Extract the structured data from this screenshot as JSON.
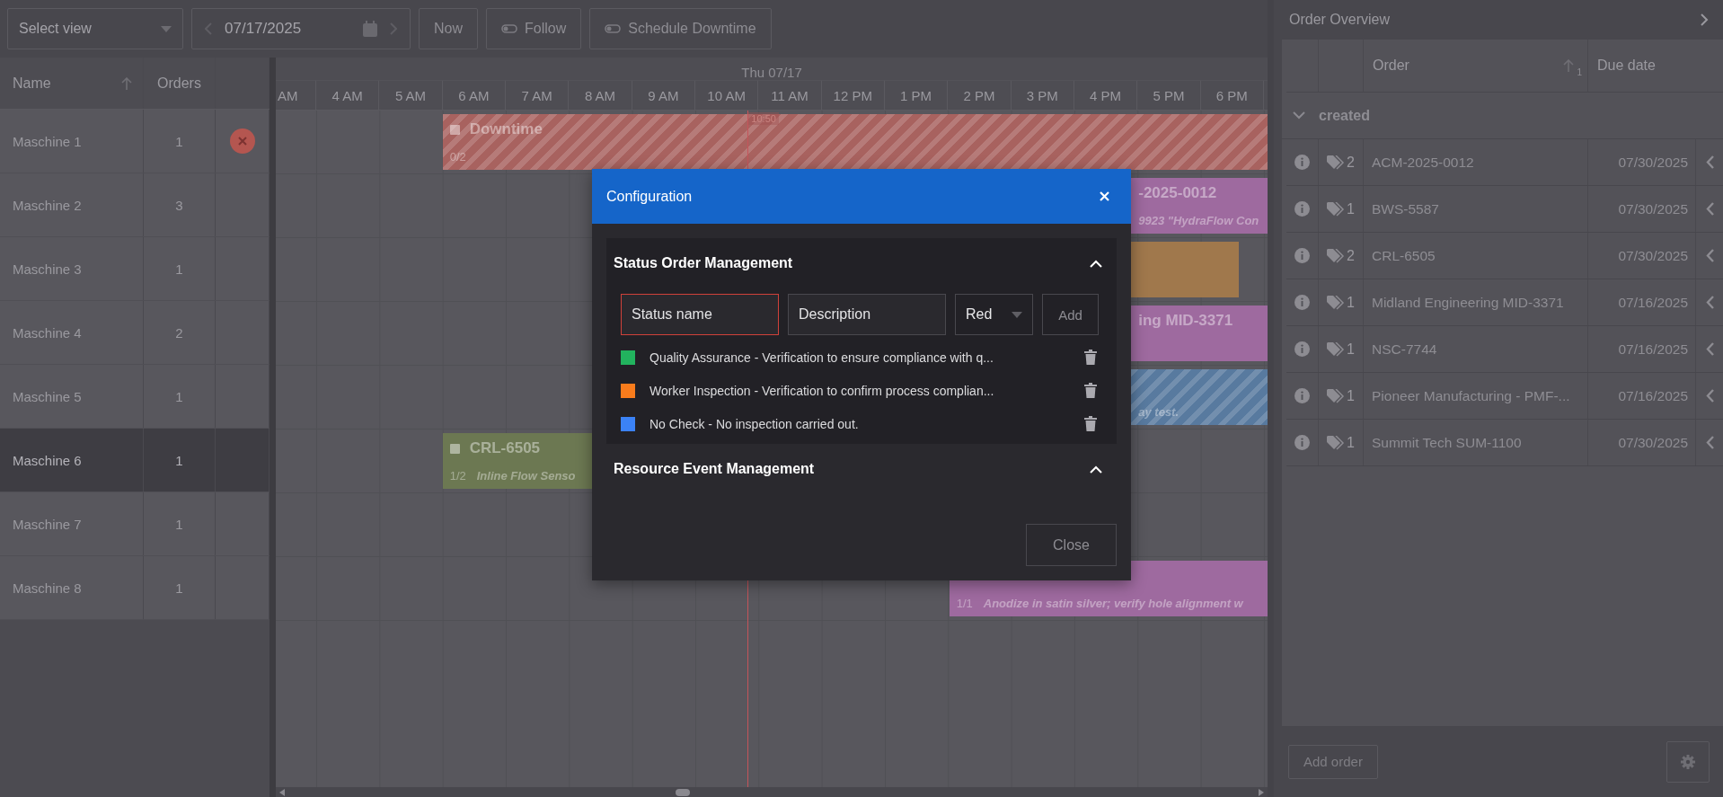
{
  "toolbar": {
    "view_select": {
      "value": "Select view"
    },
    "date": "07/17/2025",
    "buttons": [
      {
        "label": "Now",
        "kind": "plain",
        "on": false
      },
      {
        "label": "Follow",
        "kind": "toggle",
        "on": false
      },
      {
        "label": "Schedule Downtime",
        "kind": "toggle",
        "on": false
      }
    ]
  },
  "resources": {
    "columns": [
      "Name",
      "Orders"
    ],
    "rows": [
      {
        "name": "Maschine 1",
        "orders": "1",
        "cancel": true,
        "selected": false
      },
      {
        "name": "Maschine 2",
        "orders": "3",
        "cancel": false,
        "selected": false
      },
      {
        "name": "Maschine 3",
        "orders": "1",
        "cancel": false,
        "selected": false
      },
      {
        "name": "Maschine 4",
        "orders": "2",
        "cancel": false,
        "selected": false
      },
      {
        "name": "Maschine 5",
        "orders": "1",
        "cancel": false,
        "selected": false
      },
      {
        "name": "Maschine 6",
        "orders": "1",
        "cancel": false,
        "selected": true
      },
      {
        "name": "Maschine 7",
        "orders": "1",
        "cancel": false,
        "selected": false
      },
      {
        "name": "Maschine 8",
        "orders": "1",
        "cancel": false,
        "selected": false
      }
    ]
  },
  "timeline": {
    "day": "Thu 07/17",
    "hours": [
      "AM",
      "4 AM",
      "5 AM",
      "6 AM",
      "7 AM",
      "8 AM",
      "9 AM",
      "10 AM",
      "11 AM",
      "12 PM",
      "1 PM",
      "2 PM",
      "3 PM",
      "4 PM",
      "5 PM",
      "6 PM"
    ],
    "now": {
      "label": "10:50"
    },
    "rows": [
      {
        "bars": [
          {
            "title": "Downtime",
            "count": "0/2",
            "color": "#a8625f",
            "striped": true
          }
        ]
      },
      {
        "bars": [
          {
            "title": "-2025-0012",
            "subtitle": "9923 \"HydraFlow Con",
            "color": "#9e6a9f",
            "striped": false
          }
        ]
      },
      {
        "bars": [
          {
            "color": "#a0784c",
            "striped": false
          }
        ]
      },
      {
        "bars": [
          {
            "title": "ing MID-3371",
            "color": "#9e6a9f",
            "striped": false
          }
        ]
      },
      {
        "bars": [
          {
            "subtitle": "ay test.",
            "color": "#587a9f",
            "striped": true
          }
        ]
      },
      {
        "bars": [
          {
            "title": "CRL-6505",
            "count": "1/2",
            "subtitle": "Inline Flow Senso",
            "color": "#6c7852",
            "striped": false
          }
        ]
      },
      {
        "bars": []
      },
      {
        "bars": [
          {
            "count": "1/1",
            "subtitle": "Anodize in satin silver; verify hole alignment w",
            "color": "#9e6a9f",
            "striped": false
          }
        ]
      }
    ]
  },
  "order_overview": {
    "title": "Order Overview",
    "columns": [
      "Order",
      "Due date"
    ],
    "sort_rank": "1",
    "group": {
      "label": "created",
      "expanded": true
    },
    "orders": [
      {
        "tags": "2",
        "order": "ACM-2025-0012",
        "due": "07/30/2025"
      },
      {
        "tags": "1",
        "order": "BWS-5587",
        "due": "07/30/2025"
      },
      {
        "tags": "2",
        "order": "CRL-6505",
        "due": "07/30/2025"
      },
      {
        "tags": "1",
        "order": "Midland Engineering MID-3371",
        "due": "07/16/2025"
      },
      {
        "tags": "1",
        "order": "NSC-7744",
        "due": "07/16/2025"
      },
      {
        "tags": "1",
        "order": "Pioneer Manufacturing - PMF-...",
        "due": "07/16/2025"
      },
      {
        "tags": "1",
        "order": "Summit Tech SUM-1100",
        "due": "07/30/2025"
      }
    ],
    "add_button": "Add order"
  },
  "dialog": {
    "title": "Configuration",
    "sections": [
      {
        "title": "Status Order Management",
        "expanded": true,
        "form": {
          "name_placeholder": "Status name",
          "name_invalid": true,
          "description_placeholder": "Description",
          "color_choice": "Red",
          "add": "Add"
        },
        "statuses": [
          {
            "label": "Quality Assurance - Verification to ensure compliance with q...",
            "color": "#22b35e"
          },
          {
            "label": "Worker Inspection - Verification to confirm process complian...",
            "color": "#f97c1c"
          },
          {
            "label": "No Check - No inspection carried out.",
            "color": "#3b82f6"
          }
        ]
      },
      {
        "title": "Resource Event Management",
        "expanded": true
      }
    ],
    "close": "Close"
  }
}
